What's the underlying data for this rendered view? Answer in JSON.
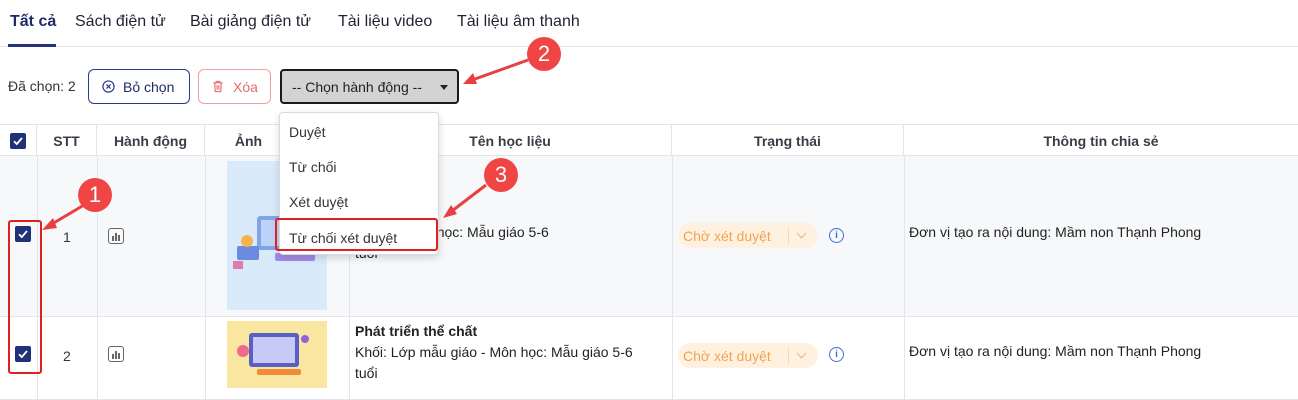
{
  "tabs": [
    {
      "label": "Tất cả",
      "active": true
    },
    {
      "label": "Sách điện tử"
    },
    {
      "label": "Bài giảng điện tử"
    },
    {
      "label": "Tài liệu video"
    },
    {
      "label": "Tài liệu âm thanh"
    }
  ],
  "toolbar": {
    "selected_count": "Đã chọn: 2",
    "unselect_label": "Bỏ chọn",
    "delete_label": "Xóa",
    "action_select_value": "-- Chọn hành động --"
  },
  "action_menu": {
    "options": [
      "Duyệt",
      "Từ chối",
      "Xét duyệt",
      "Từ chối xét duyệt"
    ]
  },
  "table": {
    "headers": {
      "stt": "STT",
      "action": "Hành động",
      "image": "Ảnh",
      "title": "Tên học liệu",
      "status": "Trạng thái",
      "share": "Thông tin chia sẻ"
    },
    "rows": [
      {
        "checked": true,
        "stt": "1",
        "title_line1": "u giáo - Môn học: Mẫu giáo 5-6",
        "title_line2": "tuổi",
        "status": "Chờ xét duyệt",
        "share": "Đơn vị tạo ra nội dung: Mầm non Thạnh Phong"
      },
      {
        "checked": true,
        "stt": "2",
        "title": "Phát triển thể chất",
        "title_line1": "Khối: Lớp mẫu giáo - Môn học: Mẫu giáo 5-6",
        "title_line2": "tuổi",
        "status": "Chờ xét duyệt",
        "share": "Đơn vị tạo ra nội dung: Mầm non Thạnh Phong"
      }
    ]
  },
  "annotations": {
    "badge_1": "1",
    "badge_2": "2",
    "badge_3": "3"
  },
  "colors": {
    "brand": "#22307a",
    "status_text": "#f2a350",
    "status_bg": "#fff1e0",
    "callout": "#e02020"
  }
}
